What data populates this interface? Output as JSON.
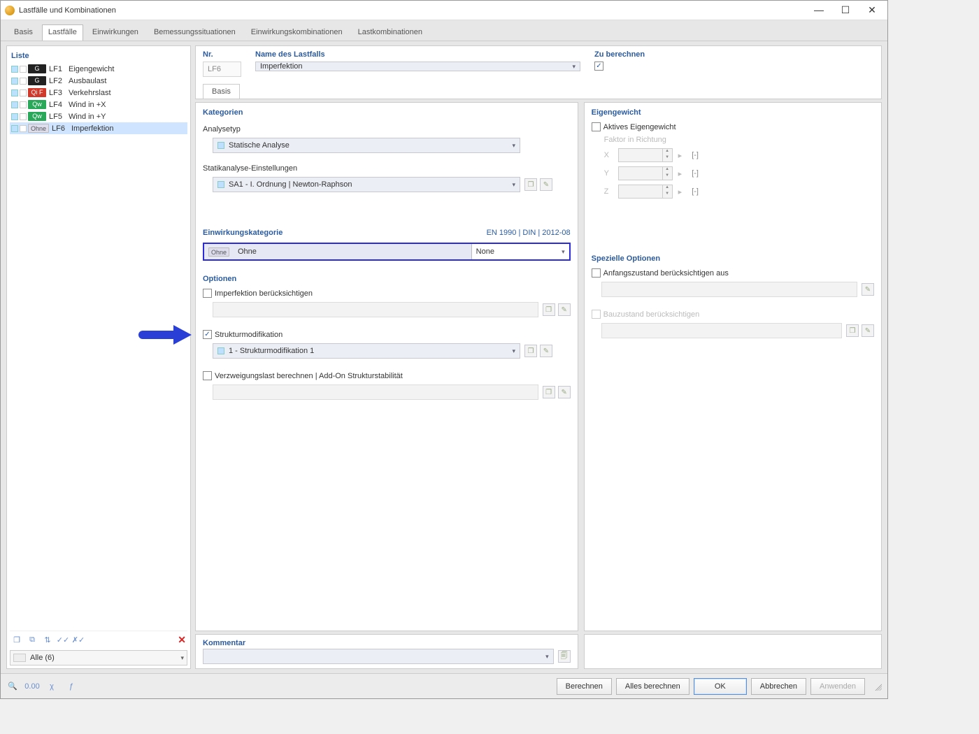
{
  "window": {
    "title": "Lastfälle und Kombinationen"
  },
  "tabs": {
    "items": [
      "Basis",
      "Lastfälle",
      "Einwirkungen",
      "Bemessungssituationen",
      "Einwirkungskombinationen",
      "Lastkombinationen"
    ],
    "active_index": 1
  },
  "left": {
    "header": "Liste",
    "loadcases": [
      {
        "tag": "G",
        "tagClass": "g",
        "code": "LF1",
        "name": "Eigengewicht"
      },
      {
        "tag": "G",
        "tagClass": "g",
        "code": "LF2",
        "name": "Ausbaulast"
      },
      {
        "tag": "Qi F",
        "tagClass": "qif",
        "code": "LF3",
        "name": "Verkehrslast"
      },
      {
        "tag": "Qw",
        "tagClass": "qw",
        "code": "LF4",
        "name": "Wind in +X"
      },
      {
        "tag": "Qw",
        "tagClass": "qw",
        "code": "LF5",
        "name": "Wind in +Y"
      },
      {
        "tag": "Ohne",
        "tagClass": "ohne",
        "code": "LF6",
        "name": "Imperfektion"
      }
    ],
    "selected_index": 5,
    "filter": "Alle (6)"
  },
  "main": {
    "nr_label": "Nr.",
    "nr_value": "LF6",
    "name_label": "Name des Lastfalls",
    "name_value": "Imperfektion",
    "compute_label": "Zu berechnen",
    "compute_checked": true,
    "subtab": "Basis",
    "categories": {
      "header": "Kategorien",
      "analysetyp_label": "Analysetyp",
      "analysetyp_value": "Statische Analyse",
      "statik_label": "Statikanalyse-Einstellungen",
      "statik_value": "SA1 - I. Ordnung | Newton-Raphson"
    },
    "selfweight": {
      "header": "Eigengewicht",
      "active_label": "Aktives Eigengewicht",
      "factor_label": "Faktor in Richtung",
      "axes": {
        "x": "X",
        "y": "Y",
        "z": "Z"
      },
      "unit": "[-]",
      "play": "▸"
    },
    "actioncat": {
      "header": "Einwirkungskategorie",
      "norm": "EN 1990 | DIN | 2012-08",
      "tag": "Ohne",
      "value": "Ohne",
      "right": "None"
    },
    "options": {
      "header": "Optionen",
      "imperf": "Imperfektion berücksichtigen",
      "strukt": "Strukturmodifikation",
      "strukt_value": "1 - Strukturmodifikation 1",
      "verzweig": "Verzweigungslast berechnen | Add-On Strukturstabilität"
    },
    "special": {
      "header": "Spezielle Optionen",
      "anfang": "Anfangszustand berücksichtigen aus",
      "bau": "Bauzustand berücksichtigen"
    },
    "comment": {
      "header": "Kommentar"
    }
  },
  "footer": {
    "berechnen": "Berechnen",
    "alles": "Alles berechnen",
    "ok": "OK",
    "abbrechen": "Abbrechen",
    "anwenden": "Anwenden"
  }
}
